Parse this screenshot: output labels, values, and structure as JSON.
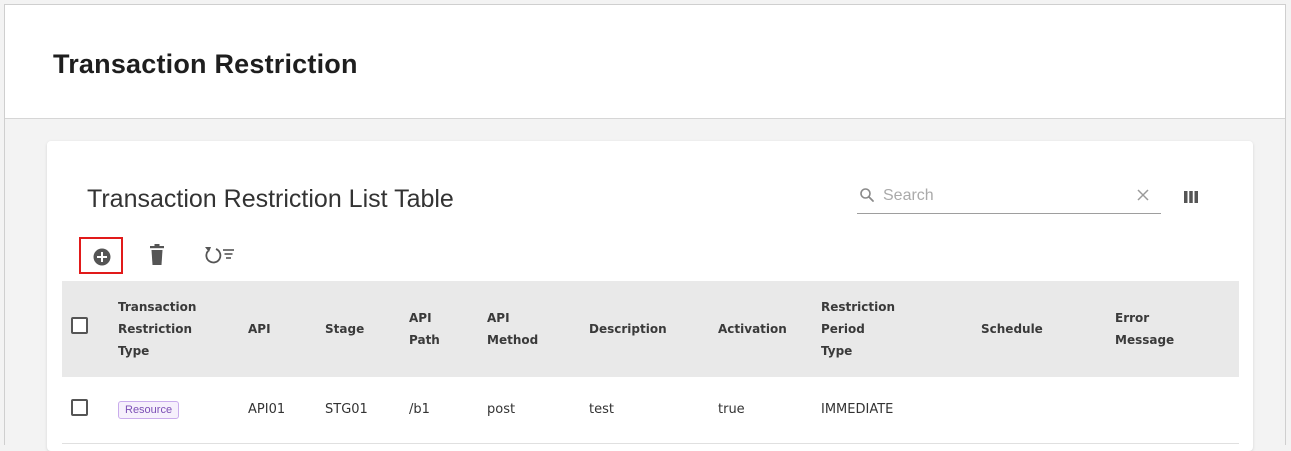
{
  "page": {
    "title": "Transaction Restriction"
  },
  "card": {
    "title": "Transaction Restriction List Table"
  },
  "search": {
    "placeholder": "Search",
    "value": ""
  },
  "icons": {
    "search": "search-icon",
    "clear": "close-icon",
    "columns": "view-column-icon",
    "add": "add-circle-icon",
    "delete": "trash-icon",
    "reset": "reset-filter-icon"
  },
  "colors": {
    "add_highlight": "#e11a1a",
    "chip_text": "#7c4fb5",
    "chip_border": "#c9acec",
    "header_bg": "#e9e9e9"
  },
  "table": {
    "columns": [
      {
        "lines": [
          "Transaction",
          "Restriction",
          "Type"
        ]
      },
      {
        "lines": [
          "API"
        ]
      },
      {
        "lines": [
          "Stage"
        ]
      },
      {
        "lines": [
          "API",
          "Path"
        ]
      },
      {
        "lines": [
          "API",
          "Method"
        ]
      },
      {
        "lines": [
          "Description"
        ]
      },
      {
        "lines": [
          "Activation"
        ]
      },
      {
        "lines": [
          "Restriction",
          "Period",
          "Type"
        ]
      },
      {
        "lines": [
          "Schedule"
        ]
      },
      {
        "lines": [
          "Error",
          "Message"
        ]
      }
    ],
    "rows": [
      {
        "type": "Resource",
        "api": "API01",
        "stage": "STG01",
        "api_path": "/b1",
        "api_method": "post",
        "description": "test",
        "activation": "true",
        "restriction_period_type": "IMMEDIATE",
        "schedule": "",
        "error_message": ""
      }
    ]
  }
}
